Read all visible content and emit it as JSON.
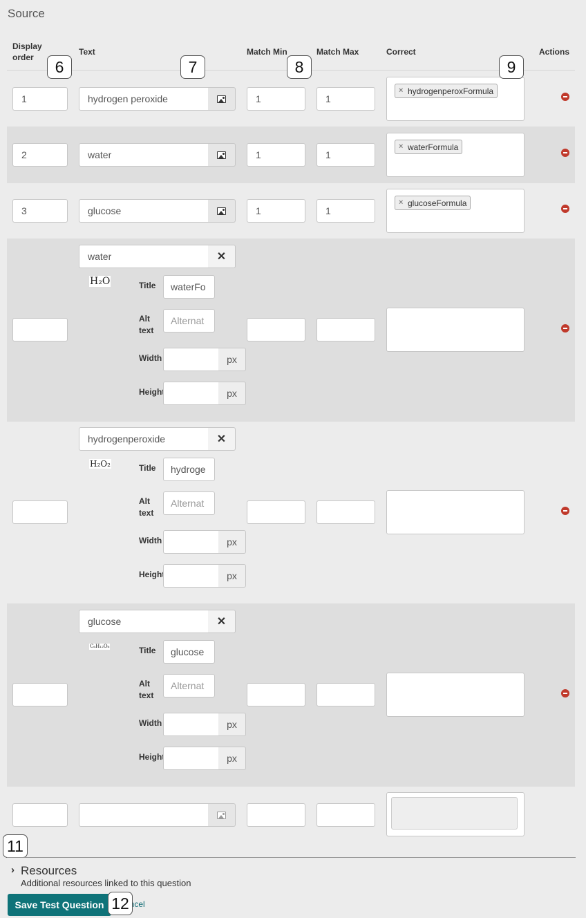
{
  "section_title": "Source",
  "headers": {
    "display_order": "Display order",
    "text": "Text",
    "match_min": "Match Min",
    "match_max": "Match Max",
    "correct": "Correct",
    "actions": "Actions"
  },
  "callouts": [
    "6",
    "7",
    "8",
    "9",
    "11",
    "12"
  ],
  "rows": [
    {
      "order": "1",
      "text": "hydrogen peroxide",
      "min": "1",
      "max": "1",
      "tag": "hydrogenperoxFormula"
    },
    {
      "order": "2",
      "text": "water",
      "min": "1",
      "max": "1",
      "tag": "waterFormula"
    },
    {
      "order": "3",
      "text": "glucose",
      "min": "1",
      "max": "1",
      "tag": "glucoseFormula"
    }
  ],
  "image_labels": {
    "title": "Title",
    "alt": "Alt text",
    "width": "Width",
    "height": "Height",
    "unit": "px"
  },
  "image_rows": [
    {
      "name": "water",
      "formula": "H₂O",
      "title_value": "waterFo",
      "alt_placeholder": "Alternat"
    },
    {
      "name": "hydrogenperoxide",
      "formula": "H₂O₂",
      "title_value": "hydroge",
      "alt_placeholder": "Alternat"
    },
    {
      "name": "glucose",
      "formula": "C₆H₁₂O₆",
      "title_value": "glucose",
      "alt_placeholder": "Alternat"
    }
  ],
  "icons": {
    "image": "image-icon",
    "remove": "minus-circle-icon",
    "clear": "times-icon",
    "tag_remove": "times-icon",
    "chevron": "chevron-right-icon"
  },
  "colors": {
    "primary_button": "#0f7379",
    "remove_icon": "#c0392b",
    "row_band": "#dedede",
    "page_bg": "#ececec"
  },
  "resources": {
    "title": "Resources",
    "subtitle": "Additional resources linked to this question"
  },
  "actions": {
    "save_label": "Save Test Question",
    "cancel_label": "ancel"
  }
}
